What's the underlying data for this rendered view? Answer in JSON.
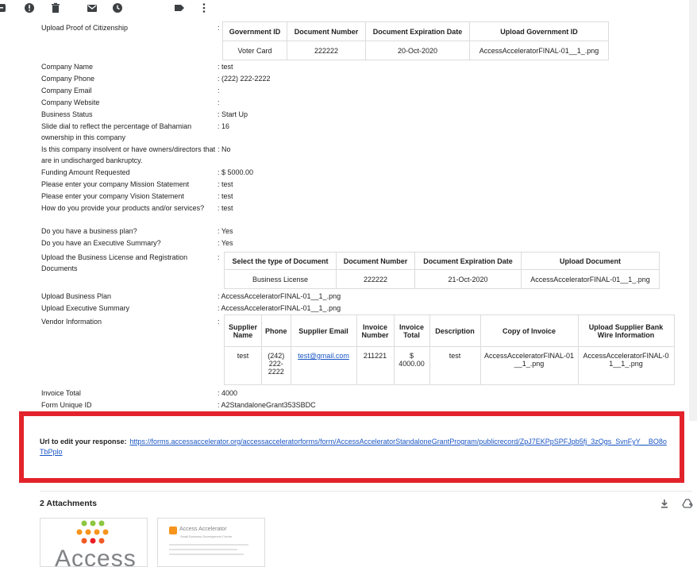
{
  "toolbar": {
    "icons": [
      "archive-icon",
      "report-spam-icon",
      "delete-icon",
      "mark-unread-icon",
      "snooze-icon",
      "label-icon",
      "more-icon"
    ]
  },
  "form": {
    "citizenship": {
      "label": "Upload Proof of Citizenship",
      "sep": ":",
      "headers": [
        "Government ID",
        "Document Number",
        "Document Expiration Date",
        "Upload Government ID"
      ],
      "row": [
        "Voter Card",
        "222222",
        "20-Oct-2020",
        "AccessAcceleratorFINAL-01__1_.png"
      ]
    },
    "fields": [
      {
        "label": "Company Name",
        "value": ": test"
      },
      {
        "label": "Company Phone",
        "value": ": (222) 222-2222"
      },
      {
        "label": "Company Email",
        "value": ":"
      },
      {
        "label": "Company Website",
        "value": ":"
      },
      {
        "label": "Business Status",
        "value": ": Start Up"
      },
      {
        "label": "Slide dial to reflect the percentage of Bahamian ownership in this company",
        "value": ": 16"
      },
      {
        "label": "Is this company insolvent or have owners/directors that are in undischarged bankruptcy.",
        "value": ": No"
      },
      {
        "label": "Funding Amount Requested",
        "value": ": $ 5000.00"
      },
      {
        "label": "Please enter your company Mission Statement",
        "value": ": test"
      },
      {
        "label": "Please enter your company Vision Statement",
        "value": ": test"
      },
      {
        "label": "How do you provide your products and/or services?",
        "value": ": test"
      },
      {
        "label": "Do you have a business plan?",
        "value": ": Yes"
      },
      {
        "label": "Do you have an Executive Summary?",
        "value": ": Yes"
      }
    ],
    "license": {
      "label": "Upload the Business License and Registration Documents",
      "sep": ":",
      "headers": [
        "Select the type of Document",
        "Document Number",
        "Document Expiration Date",
        "Upload Document"
      ],
      "row": [
        "Business License",
        "222222",
        "21-Oct-2020",
        "AccessAcceleratorFINAL-01__1_.png"
      ]
    },
    "business_plan": {
      "label": "Upload Business Plan",
      "value": ": AccessAcceleratorFINAL-01__1_.png"
    },
    "exec_summary": {
      "label": "Upload Executive Summary",
      "value": ": AccessAcceleratorFINAL-01__1_.png"
    },
    "vendor": {
      "label": "Vendor Information",
      "sep": ":",
      "headers": [
        "Supplier Name",
        "Phone",
        "Supplier Email",
        "Invoice Number",
        "Invoice Total",
        "Description",
        "Copy of Invoice",
        "Upload Supplier Bank Wire Information"
      ],
      "row": [
        "test",
        "(242) 222-2222",
        "test@gmail.com",
        "211221",
        "$ 4000.00",
        "test",
        "AccessAcceleratorFINAL-01__1_.png",
        "AccessAcceleratorFINAL-01__1_.png"
      ]
    },
    "invoice_total": {
      "label": "Invoice Total",
      "value": ": 4000"
    },
    "unique_id": {
      "label": "Form Unique ID",
      "value": ": A2StandaloneGrant353SBDC"
    }
  },
  "edit": {
    "label": "Url to edit your response:",
    "url": "https://forms.accessaccelerator.org/accessacceleratorforms/form/AccessAcceleratorStandaloneGrantProgram/publicrecord/ZpJ7EKPpSPFJpb5fj_3zQgs_SvnFyY__BO8oTbPplo",
    "highlight_color": "#e3232b"
  },
  "attachments": {
    "title": "2 Attachments",
    "download_icon": "download-all-icon",
    "drive_icon": "add-to-drive-icon",
    "thumb1_text": "Access",
    "thumb2_logo": "Access Accelerator",
    "thumb2_sub": "Small Business Development Centre"
  }
}
